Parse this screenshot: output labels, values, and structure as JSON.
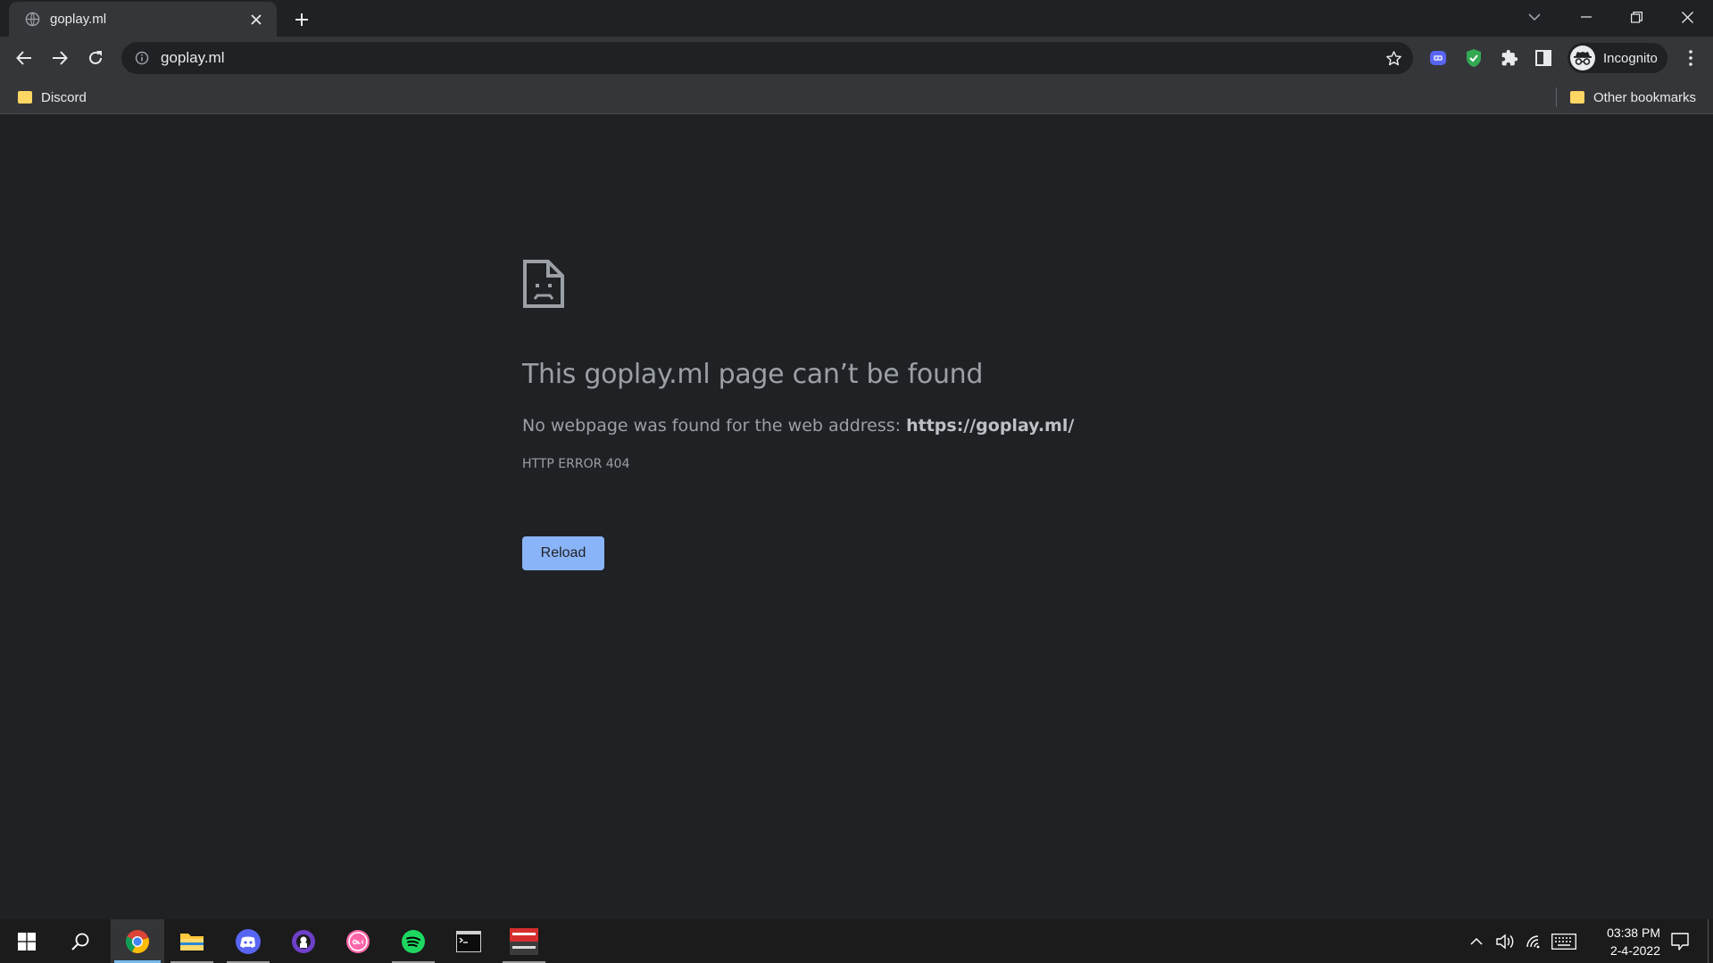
{
  "browser": {
    "tab": {
      "title": "goplay.ml"
    },
    "address_bar": {
      "url": "goplay.ml"
    },
    "profile_label": "Incognito",
    "bookmarks": [
      {
        "label": "Discord"
      }
    ],
    "other_bookmarks_label": "Other bookmarks"
  },
  "error_page": {
    "title": "This goplay.ml page can’t be found",
    "description_prefix": "No webpage was found for the web address:",
    "description_url": "https://goplay.ml/",
    "error_code": "HTTP ERROR 404",
    "reload_label": "Reload"
  },
  "taskbar": {
    "apps": [
      {
        "name": "chrome",
        "state": "active"
      },
      {
        "name": "file-explorer",
        "state": "running"
      },
      {
        "name": "discord",
        "state": "running"
      },
      {
        "name": "github-desktop",
        "state": "idle"
      },
      {
        "name": "osu",
        "state": "idle"
      },
      {
        "name": "spotify",
        "state": "running"
      },
      {
        "name": "terminal",
        "state": "idle"
      },
      {
        "name": "voicemeeter",
        "state": "running"
      }
    ],
    "clock": {
      "time": "03:38 PM",
      "date": "2-4-2022"
    }
  },
  "colors": {
    "page_bg": "#202124",
    "toolbar_bg": "#35363a",
    "accent_button": "#8ab4f8",
    "text_muted": "#9aa0a6",
    "taskbar_bg": "#1b1b1c"
  }
}
